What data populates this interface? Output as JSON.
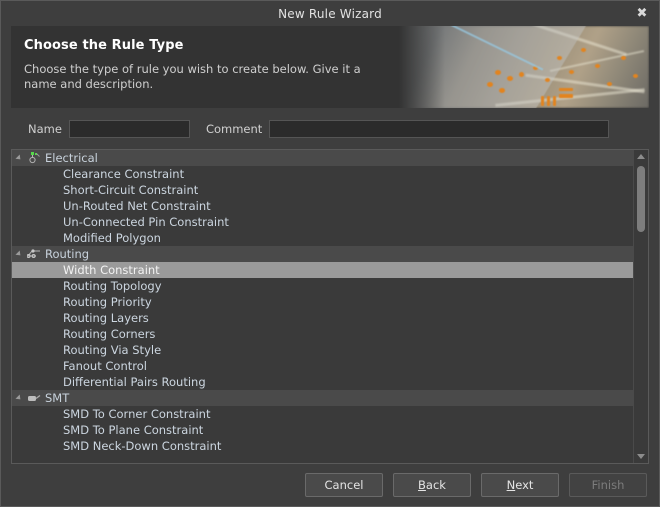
{
  "window": {
    "title": "New Rule Wizard",
    "close_icon": "close-icon"
  },
  "header": {
    "title": "Choose the Rule Type",
    "subtitle": "Choose the type of rule you wish to create below. Give it a name and description."
  },
  "form": {
    "name_label": "Name",
    "name_value": "",
    "name_placeholder": "",
    "comment_label": "Comment",
    "comment_value": "",
    "comment_placeholder": ""
  },
  "tree": {
    "selected": "Width Constraint",
    "groups": [
      {
        "label": "Electrical",
        "icon": "electrical-component-icon",
        "expanded": true,
        "items": [
          "Clearance Constraint",
          "Short-Circuit Constraint",
          "Un-Routed Net Constraint",
          "Un-Connected Pin Constraint",
          "Modified Polygon"
        ]
      },
      {
        "label": "Routing",
        "icon": "routing-net-icon",
        "expanded": true,
        "items": [
          "Width Constraint",
          "Routing Topology",
          "Routing Priority",
          "Routing Layers",
          "Routing Corners",
          "Routing Via Style",
          "Fanout Control",
          "Differential Pairs Routing"
        ]
      },
      {
        "label": "SMT",
        "icon": "smt-pad-icon",
        "expanded": true,
        "items": [
          "SMD To Corner Constraint",
          "SMD To Plane Constraint",
          "SMD Neck-Down Constraint"
        ]
      }
    ]
  },
  "scrollbar": {
    "up_icon": "scroll-up-arrow-icon",
    "down_icon": "scroll-down-arrow-icon"
  },
  "buttons": {
    "cancel": "Cancel",
    "back": "Back",
    "back_accel": "B",
    "next": "Next",
    "next_accel": "N",
    "finish": "Finish",
    "finish_enabled": false
  },
  "colors": {
    "dialog_bg": "#3e3e3e",
    "panel_bg": "#3a3a3a",
    "header_bg": "#333333",
    "selection": "#9a9a9a",
    "group_row": "#4a4a4a",
    "text": "#ccd6e0",
    "accent_orange": "#e2841f"
  }
}
